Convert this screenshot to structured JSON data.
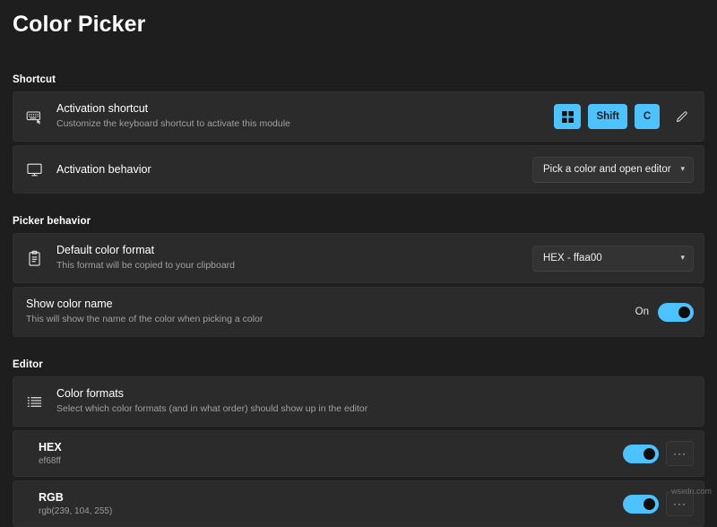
{
  "page": {
    "title": "Color Picker",
    "watermark": "wsxdn.com"
  },
  "sections": {
    "shortcut": {
      "header": "Shortcut",
      "activation_shortcut": {
        "icon": "keyboard-icon",
        "title": "Activation shortcut",
        "subtitle": "Customize the keyboard shortcut to activate this module",
        "keys": [
          "windows-logo-icon",
          "Shift",
          "C"
        ],
        "edit_icon": "pencil-icon"
      },
      "activation_behavior": {
        "icon": "monitor-icon",
        "title": "Activation behavior",
        "dropdown_value": "Pick a color and open editor"
      }
    },
    "picker_behavior": {
      "header": "Picker behavior",
      "default_color_format": {
        "icon": "clipboard-icon",
        "title": "Default color format",
        "subtitle": "This format will be copied to your clipboard",
        "dropdown_value": "HEX - ffaa00"
      },
      "show_color_name": {
        "title": "Show color name",
        "subtitle": "This will show the name of the color when picking a color",
        "toggle_label": "On",
        "toggle_state": "on"
      }
    },
    "editor": {
      "header": "Editor",
      "color_formats": {
        "icon": "list-icon",
        "title": "Color formats",
        "subtitle": "Select which color formats (and in what order) should show up in the editor"
      },
      "formats": [
        {
          "name": "HEX",
          "sample": "ef68ff",
          "toggle_state": "on",
          "more_label": "···"
        },
        {
          "name": "RGB",
          "sample": "rgb(239, 104, 255)",
          "toggle_state": "on",
          "more_label": "···"
        }
      ]
    }
  },
  "colors": {
    "accent": "#4cc2ff",
    "page_bg": "#1e1e1e",
    "card_bg": "#2b2b2b"
  }
}
